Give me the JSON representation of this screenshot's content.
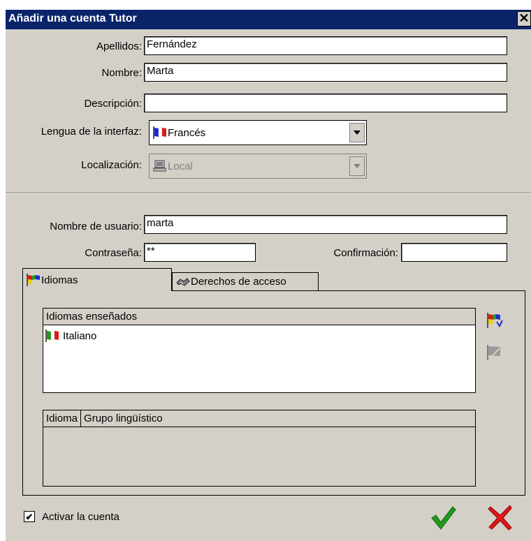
{
  "window": {
    "title": "Añadir una cuenta Tutor",
    "close_glyph": "✕"
  },
  "form": {
    "apellidos_label": "Apellidos:",
    "apellidos_value": "Fernández",
    "nombre_label": "Nombre:",
    "nombre_value": "Marta",
    "descripcion_label": "Descripción:",
    "descripcion_value": "",
    "lengua_label": "Lengua de la interfaz:",
    "lengua_value": "Francés",
    "localizacion_label": "Localización:",
    "localizacion_value": "Local",
    "usuario_label": "Nombre de usuario:",
    "usuario_value": "marta",
    "contrasena_label": "Contraseña:",
    "contrasena_value": "**",
    "confirmacion_label": "Confirmación:",
    "confirmacion_value": ""
  },
  "tabs": [
    {
      "label": "Idiomas",
      "icon": "language-flags-icon",
      "active": true
    },
    {
      "label": "Derechos de acceso",
      "icon": "handshake-icon",
      "active": false
    }
  ],
  "taught_languages": {
    "header": "Idiomas enseñados",
    "items": [
      {
        "label": "Italiano",
        "icon": "italian-flag-icon"
      }
    ]
  },
  "groups_table": {
    "columns": [
      "Idioma",
      "Grupo lingüístico"
    ],
    "rows": []
  },
  "footer": {
    "activate_label": "Activar la cuenta",
    "activate_checked": true,
    "ok_icon": "green-check-icon",
    "cancel_icon": "red-x-icon"
  },
  "colors": {
    "titlebar": "#0a246a",
    "dialog_bg": "#d4d0c8",
    "ok": "#1e9b1e",
    "cancel": "#e01818"
  }
}
